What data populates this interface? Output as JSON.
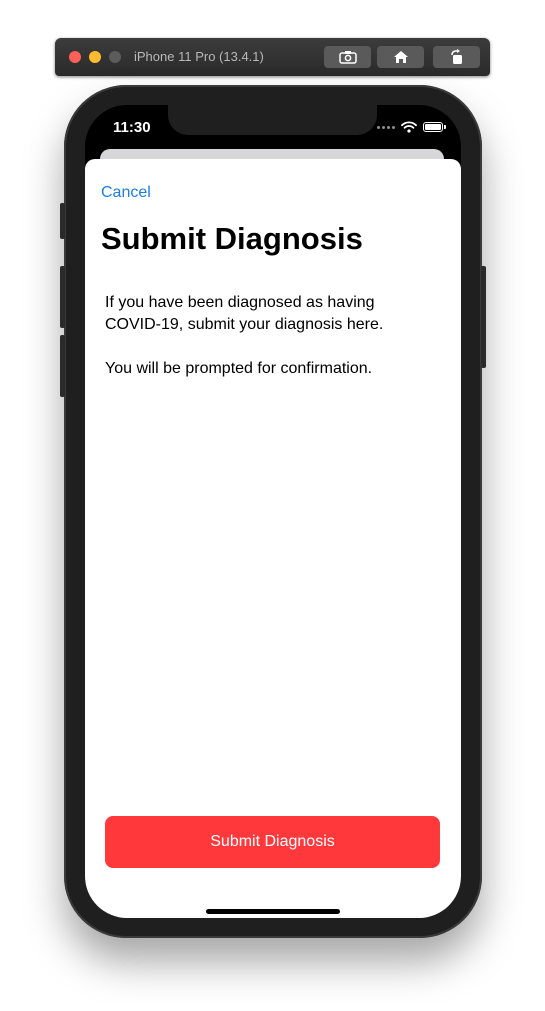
{
  "window": {
    "title": "iPhone 11 Pro (13.4.1)",
    "buttons": [
      "screenshot-icon",
      "home-icon",
      "rotate-icon"
    ]
  },
  "status_bar": {
    "time": "11:30",
    "icons": [
      "cellular-signal-icon",
      "wifi-icon",
      "battery-icon"
    ]
  },
  "sheet": {
    "cancel_label": "Cancel",
    "title": "Submit Diagnosis",
    "paragraphs": [
      "If you have been diagnosed as having COVID-19, submit your diagnosis here.",
      "You will be prompted for confirmation."
    ],
    "submit_label": "Submit Diagnosis"
  },
  "colors": {
    "accent": "#1a7fe0",
    "submit_button": "#ff383c"
  }
}
